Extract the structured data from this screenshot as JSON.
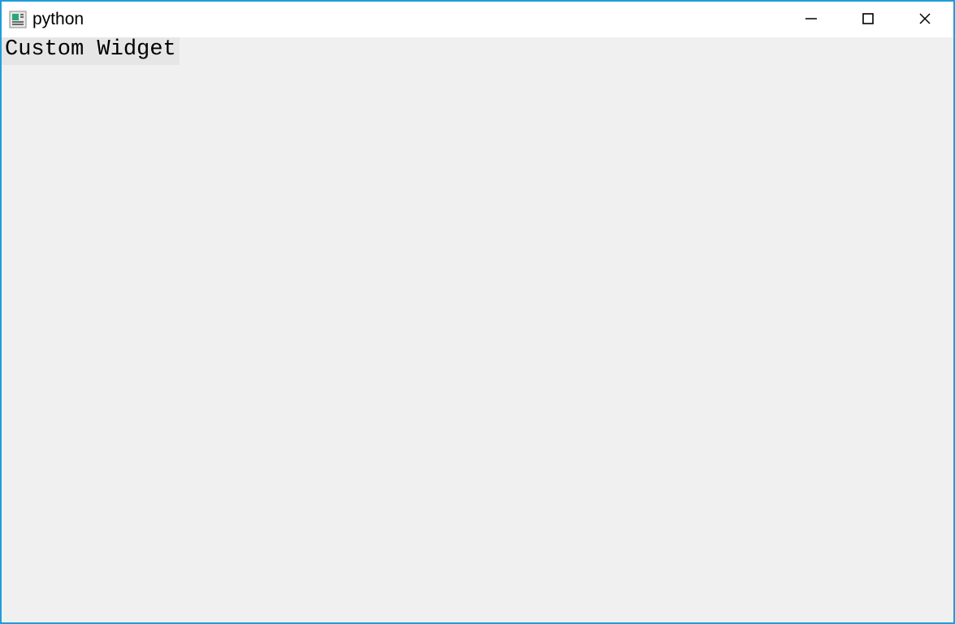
{
  "window": {
    "title": "python",
    "border_color": "#1e9ed8"
  },
  "content": {
    "custom_widget_label": "Custom Widget",
    "client_bg": "#f0f0f0",
    "widget_bg": "#e6e6e6"
  },
  "controls": {
    "minimize": "minimize",
    "maximize": "maximize",
    "close": "close"
  }
}
